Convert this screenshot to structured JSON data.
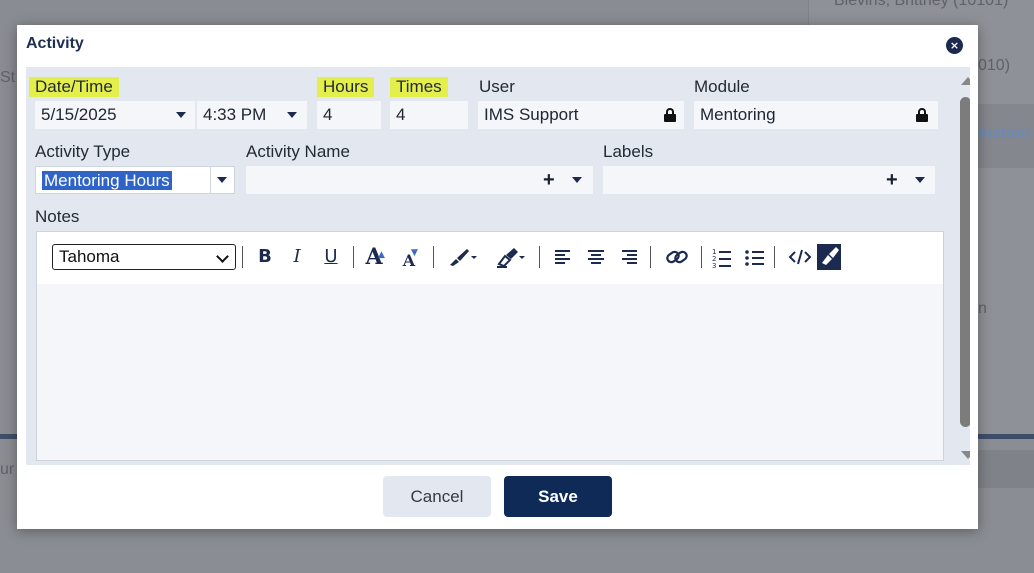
{
  "background": {
    "right_name": "Blevins, Brittney (10101)",
    "right_code": "010)",
    "right_partial": "mation",
    "right_partial2": "n",
    "left_partial": "St",
    "left_bottom_partial": "ur"
  },
  "dialog": {
    "title": "Activity",
    "close_label": "×",
    "labels": {
      "date_time": "Date/Time",
      "hours": "Hours",
      "times": "Times",
      "user": "User",
      "module": "Module",
      "activity_type": "Activity Type",
      "activity_name": "Activity Name",
      "labels": "Labels",
      "notes": "Notes"
    },
    "values": {
      "date": "5/15/2025",
      "time": "4:33 PM",
      "hours": "4",
      "times": "4",
      "user": "IMS Support",
      "module": "Mentoring",
      "activity_type": "Mentoring Hours",
      "activity_name": "",
      "labels": ""
    },
    "editor": {
      "font": "Tahoma",
      "toolbar_icons": [
        "bold-icon",
        "italic-icon",
        "underline-icon",
        "font-size-increase-icon",
        "font-size-decrease-icon",
        "text-color-icon",
        "highlight-color-icon",
        "align-left-icon",
        "align-center-icon",
        "align-right-icon",
        "link-icon",
        "ordered-list-icon",
        "unordered-list-icon",
        "code-view-icon",
        "clear-format-icon"
      ],
      "bold": "B",
      "italic": "I",
      "underline": "U",
      "grow": "A",
      "shrink": "A"
    },
    "buttons": {
      "cancel": "Cancel",
      "save": "Save"
    }
  },
  "colors": {
    "highlight": "#e4ef4c",
    "primary": "#0f2a57",
    "selection": "#2f63c7"
  }
}
